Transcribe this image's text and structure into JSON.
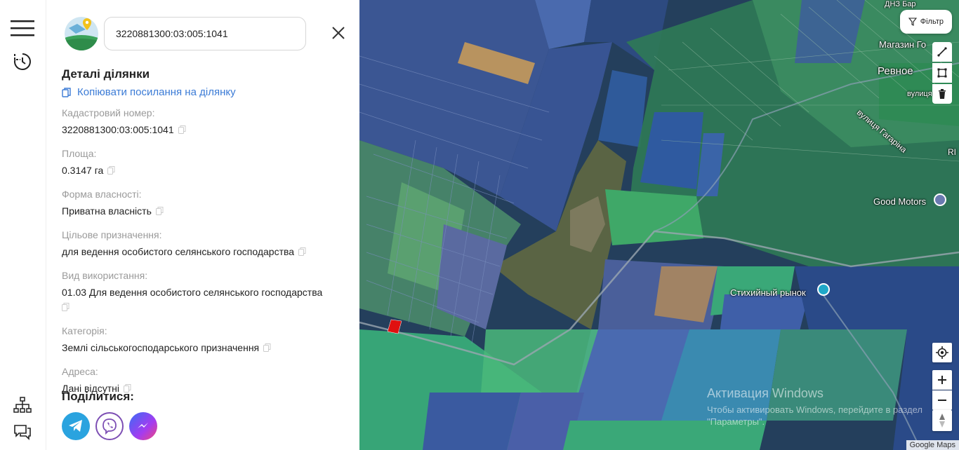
{
  "search": {
    "value": "3220881300:03:005:1041"
  },
  "details": {
    "title": "Деталі ділянки",
    "copy_link": "Копіювати посилання на ділянку",
    "fields": [
      {
        "label": "Кадастровий номер:",
        "value": "3220881300:03:005:1041"
      },
      {
        "label": "Площа:",
        "value": "0.3147 га"
      },
      {
        "label": "Форма власності:",
        "value": "Приватна власність"
      },
      {
        "label": "Цільове призначення:",
        "value": "для ведення особистого селянського господарства"
      },
      {
        "label": "Вид використання:",
        "value": "01.03 Для ведення особистого селянського господарства"
      },
      {
        "label": "Категорія:",
        "value": "Землі сільськогосподарського призначення"
      },
      {
        "label": "Адреса:",
        "value": "Дані відсутні"
      }
    ],
    "share_title": "Поділитися:"
  },
  "map": {
    "filter_label": "Фільтр",
    "labels": {
      "magazin": "Магазин Го",
      "revnoe": "Ревное",
      "gagarina": "вулиця Гагаріна",
      "good_motors": "Good Motors",
      "market": "Стихийный рынок",
      "dnz": "ДНЗ Бар",
      "vulytsia": "вулиця",
      "ri": "RI"
    },
    "watermark_title": "Активация Windows",
    "watermark_text": "Чтобы активировать Windows, перейдите в раздел \"Параметры\".",
    "attribution": "Google Maps"
  },
  "colors": {
    "accent": "#3b7bd6",
    "parcel_blue": "#3f5fa8",
    "parcel_green": "#3fa86a",
    "selected": "#e01010"
  },
  "icons": [
    "menu-icon",
    "history-icon",
    "sitemap-icon",
    "chat-icon",
    "close-icon",
    "copy-icon",
    "telegram-icon",
    "viber-icon",
    "messenger-icon",
    "filter-icon",
    "ruler-icon",
    "polygon-icon",
    "trash-icon",
    "locate-icon",
    "compass-icon"
  ]
}
